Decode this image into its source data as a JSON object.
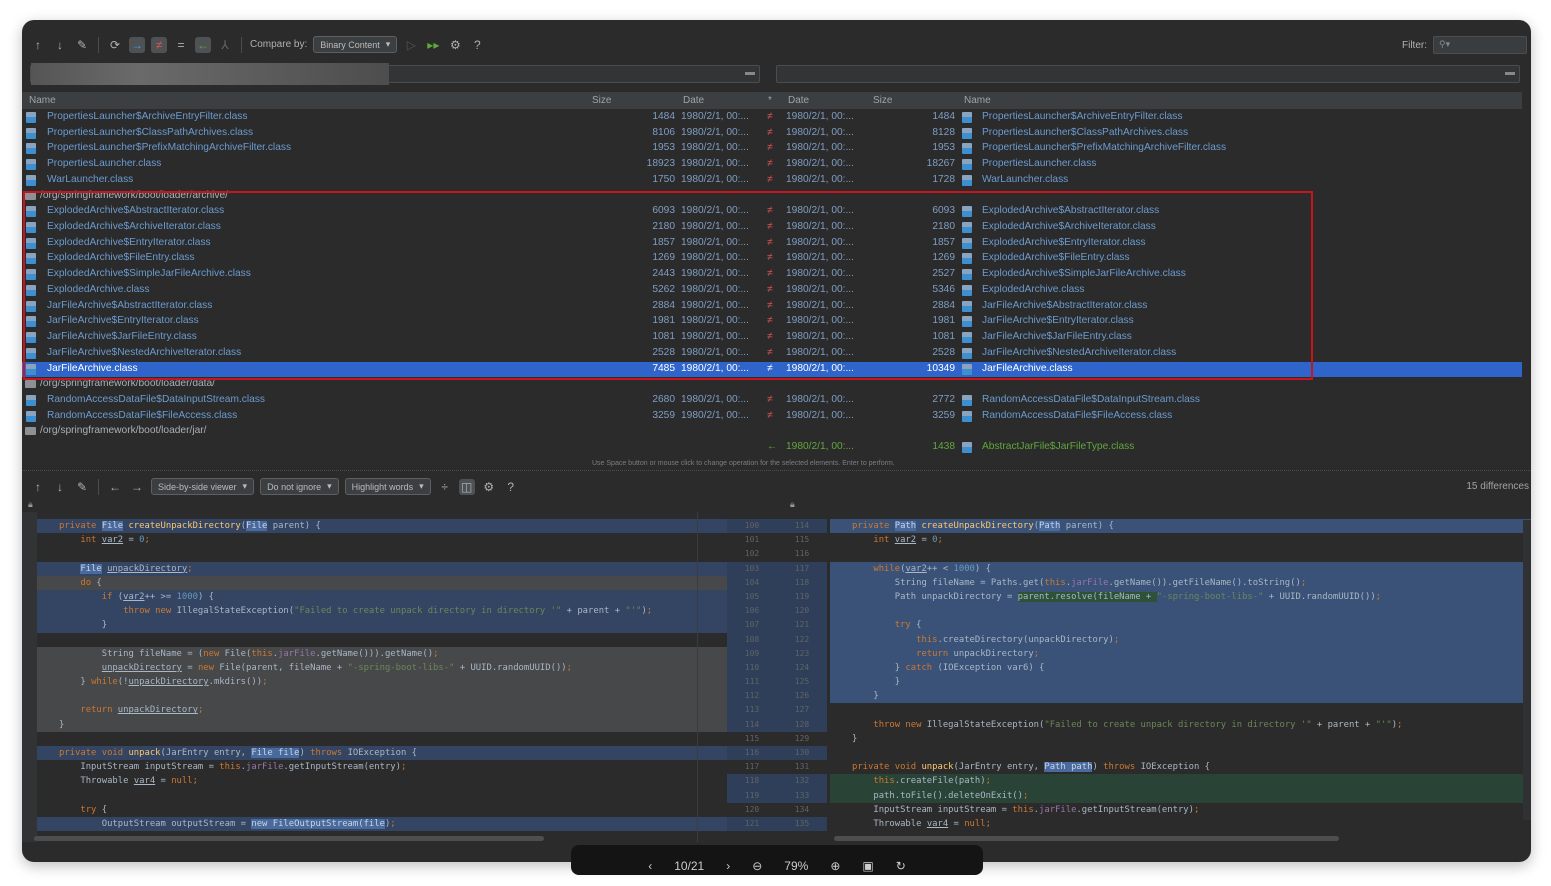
{
  "toolbar": {
    "compare_by_label": "Compare by:",
    "compare_by_value": "Binary Content",
    "filter_label": "Filter:",
    "filter_value": ""
  },
  "columns": {
    "name_left": "Name",
    "size_left": "Size",
    "date_left": "Date",
    "marker": "*",
    "date_right": "Date",
    "size_right": "Size",
    "name_right": "Name"
  },
  "rows": [
    {
      "type": "file",
      "left": "PropertiesLauncher$ArchiveEntryFilter.class",
      "lsize": "1484",
      "ldate": "1980/2/1, 00:...",
      "op": "≠",
      "rdate": "1980/2/1, 00:...",
      "rsize": "1484",
      "right": "PropertiesLauncher$ArchiveEntryFilter.class"
    },
    {
      "type": "file",
      "left": "PropertiesLauncher$ClassPathArchives.class",
      "lsize": "8106",
      "ldate": "1980/2/1, 00:...",
      "op": "≠",
      "rdate": "1980/2/1, 00:...",
      "rsize": "8128",
      "right": "PropertiesLauncher$ClassPathArchives.class"
    },
    {
      "type": "file",
      "left": "PropertiesLauncher$PrefixMatchingArchiveFilter.class",
      "lsize": "1953",
      "ldate": "1980/2/1, 00:...",
      "op": "≠",
      "rdate": "1980/2/1, 00:...",
      "rsize": "1953",
      "right": "PropertiesLauncher$PrefixMatchingArchiveFilter.class"
    },
    {
      "type": "file",
      "left": "PropertiesLauncher.class",
      "lsize": "18923",
      "ldate": "1980/2/1, 00:...",
      "op": "≠",
      "rdate": "1980/2/1, 00:...",
      "rsize": "18267",
      "right": "PropertiesLauncher.class"
    },
    {
      "type": "file",
      "left": "WarLauncher.class",
      "lsize": "1750",
      "ldate": "1980/2/1, 00:...",
      "op": "≠",
      "rdate": "1980/2/1, 00:...",
      "rsize": "1728",
      "right": "WarLauncher.class"
    },
    {
      "type": "folder",
      "left": "/org/springframework/boot/loader/archive/"
    },
    {
      "type": "file",
      "left": "ExplodedArchive$AbstractIterator.class",
      "lsize": "6093",
      "ldate": "1980/2/1, 00:...",
      "op": "≠",
      "rdate": "1980/2/1, 00:...",
      "rsize": "6093",
      "right": "ExplodedArchive$AbstractIterator.class"
    },
    {
      "type": "file",
      "left": "ExplodedArchive$ArchiveIterator.class",
      "lsize": "2180",
      "ldate": "1980/2/1, 00:...",
      "op": "≠",
      "rdate": "1980/2/1, 00:...",
      "rsize": "2180",
      "right": "ExplodedArchive$ArchiveIterator.class"
    },
    {
      "type": "file",
      "left": "ExplodedArchive$EntryIterator.class",
      "lsize": "1857",
      "ldate": "1980/2/1, 00:...",
      "op": "≠",
      "rdate": "1980/2/1, 00:...",
      "rsize": "1857",
      "right": "ExplodedArchive$EntryIterator.class"
    },
    {
      "type": "file",
      "left": "ExplodedArchive$FileEntry.class",
      "lsize": "1269",
      "ldate": "1980/2/1, 00:...",
      "op": "≠",
      "rdate": "1980/2/1, 00:...",
      "rsize": "1269",
      "right": "ExplodedArchive$FileEntry.class"
    },
    {
      "type": "file",
      "left": "ExplodedArchive$SimpleJarFileArchive.class",
      "lsize": "2443",
      "ldate": "1980/2/1, 00:...",
      "op": "≠",
      "rdate": "1980/2/1, 00:...",
      "rsize": "2527",
      "right": "ExplodedArchive$SimpleJarFileArchive.class"
    },
    {
      "type": "file",
      "left": "ExplodedArchive.class",
      "lsize": "5262",
      "ldate": "1980/2/1, 00:...",
      "op": "≠",
      "rdate": "1980/2/1, 00:...",
      "rsize": "5346",
      "right": "ExplodedArchive.class"
    },
    {
      "type": "file",
      "left": "JarFileArchive$AbstractIterator.class",
      "lsize": "2884",
      "ldate": "1980/2/1, 00:...",
      "op": "≠",
      "rdate": "1980/2/1, 00:...",
      "rsize": "2884",
      "right": "JarFileArchive$AbstractIterator.class"
    },
    {
      "type": "file",
      "left": "JarFileArchive$EntryIterator.class",
      "lsize": "1981",
      "ldate": "1980/2/1, 00:...",
      "op": "≠",
      "rdate": "1980/2/1, 00:...",
      "rsize": "1981",
      "right": "JarFileArchive$EntryIterator.class"
    },
    {
      "type": "file",
      "left": "JarFileArchive$JarFileEntry.class",
      "lsize": "1081",
      "ldate": "1980/2/1, 00:...",
      "op": "≠",
      "rdate": "1980/2/1, 00:...",
      "rsize": "1081",
      "right": "JarFileArchive$JarFileEntry.class"
    },
    {
      "type": "file",
      "left": "JarFileArchive$NestedArchiveIterator.class",
      "lsize": "2528",
      "ldate": "1980/2/1, 00:...",
      "op": "≠",
      "rdate": "1980/2/1, 00:...",
      "rsize": "2528",
      "right": "JarFileArchive$NestedArchiveIterator.class"
    },
    {
      "type": "file",
      "selected": true,
      "left": "JarFileArchive.class",
      "lsize": "7485",
      "ldate": "1980/2/1, 00:...",
      "op": "≠",
      "rdate": "1980/2/1, 00:...",
      "rsize": "10349",
      "right": "JarFileArchive.class"
    },
    {
      "type": "folder",
      "left": "/org/springframework/boot/loader/data/"
    },
    {
      "type": "file",
      "left": "RandomAccessDataFile$DataInputStream.class",
      "lsize": "2680",
      "ldate": "1980/2/1, 00:...",
      "op": "≠",
      "rdate": "1980/2/1, 00:...",
      "rsize": "2772",
      "right": "RandomAccessDataFile$DataInputStream.class"
    },
    {
      "type": "file",
      "left": "RandomAccessDataFile$FileAccess.class",
      "lsize": "3259",
      "ldate": "1980/2/1, 00:...",
      "op": "≠",
      "rdate": "1980/2/1, 00:...",
      "rsize": "3259",
      "right": "RandomAccessDataFile$FileAccess.class"
    },
    {
      "type": "folder",
      "left": "/org/springframework/boot/loader/jar/"
    },
    {
      "type": "rightonly",
      "left": "",
      "lsize": "",
      "ldate": "",
      "op": "←",
      "rdate": "1980/2/1, 00:...",
      "rsize": "1438",
      "right": "AbstractJarFile$JarFileType.class"
    }
  ],
  "status_hint": "Use Space button or mouse click to change operation for the selected elements. Enter to perform.",
  "diff_toolbar": {
    "viewer": "Side-by-side viewer",
    "ignore": "Do not ignore",
    "highlight": "Highlight words",
    "differences": "15 differences"
  },
  "left_code": [
    {
      "bg": "chg",
      "t": [
        [
          "k",
          "private "
        ],
        [
          "h",
          "File"
        ],
        [
          "p",
          " "
        ],
        [
          "m",
          "createUnpackDirectory"
        ],
        [
          "p",
          "("
        ],
        [
          "h",
          "File"
        ],
        [
          "p",
          " parent) {"
        ]
      ]
    },
    {
      "bg": "",
      "t": [
        [
          "p",
          "    "
        ],
        [
          "k",
          "int "
        ],
        [
          "u",
          "var2"
        ],
        [
          "p",
          " = "
        ],
        [
          "n",
          "0"
        ],
        [
          "k",
          ";"
        ]
      ]
    },
    {
      "bg": "",
      "t": []
    },
    {
      "bg": "chg",
      "t": [
        [
          "p",
          "    "
        ],
        [
          "h",
          "File"
        ],
        [
          "p",
          " "
        ],
        [
          "u",
          "unpackDirectory"
        ],
        [
          "k",
          ";"
        ]
      ]
    },
    {
      "bg": "mod",
      "t": [
        [
          "p",
          "    "
        ],
        [
          "k",
          "do"
        ],
        [
          "p",
          " {"
        ]
      ]
    },
    {
      "bg": "chg",
      "t": [
        [
          "p",
          "        "
        ],
        [
          "k",
          "if"
        ],
        [
          "p",
          " ("
        ],
        [
          "u",
          "var2"
        ],
        [
          "p",
          "++ >= "
        ],
        [
          "n",
          "1000"
        ],
        [
          "p",
          ") {"
        ]
      ]
    },
    {
      "bg": "chg",
      "t": [
        [
          "p",
          "            "
        ],
        [
          "k",
          "throw new "
        ],
        [
          "p",
          "IllegalStateException("
        ],
        [
          "s",
          "\"Failed to create unpack directory in directory '\""
        ],
        [
          "p",
          " + parent + "
        ],
        [
          "s",
          "\"'\""
        ],
        [
          "p",
          ")"
        ],
        [
          "k",
          ";"
        ]
      ]
    },
    {
      "bg": "chg",
      "t": [
        [
          "p",
          "        }"
        ]
      ]
    },
    {
      "bg": "",
      "t": []
    },
    {
      "bg": "mod",
      "t": [
        [
          "p",
          "        String fileName = ("
        ],
        [
          "k",
          "new "
        ],
        [
          "p",
          "File("
        ],
        [
          "k",
          "this"
        ],
        [
          "p",
          "."
        ],
        [
          "f",
          "jarFile"
        ],
        [
          "p",
          ".getName())).getName()"
        ],
        [
          "k",
          ";"
        ]
      ]
    },
    {
      "bg": "mod",
      "t": [
        [
          "p",
          "        "
        ],
        [
          "u",
          "unpackDirectory"
        ],
        [
          "p",
          " = "
        ],
        [
          "k",
          "new "
        ],
        [
          "p",
          "File(parent, fileName + "
        ],
        [
          "s",
          "\"-spring-boot-libs-\""
        ],
        [
          "p",
          " + UUID.randomUUID())"
        ],
        [
          "k",
          ";"
        ]
      ]
    },
    {
      "bg": "mod",
      "t": [
        [
          "p",
          "    } "
        ],
        [
          "k",
          "while"
        ],
        [
          "p",
          "(!"
        ],
        [
          "u",
          "unpackDirectory"
        ],
        [
          "p",
          ".mkdirs())"
        ],
        [
          "k",
          ";"
        ]
      ]
    },
    {
      "bg": "mod",
      "t": []
    },
    {
      "bg": "mod",
      "t": [
        [
          "p",
          "    "
        ],
        [
          "k",
          "return "
        ],
        [
          "u",
          "unpackDirectory"
        ],
        [
          "k",
          ";"
        ]
      ]
    },
    {
      "bg": "mod",
      "t": [
        [
          "p",
          "}"
        ]
      ]
    },
    {
      "bg": "",
      "t": []
    },
    {
      "bg": "chg",
      "t": [
        [
          "k",
          "private void "
        ],
        [
          "m",
          "unpack"
        ],
        [
          "p",
          "(JarEntry entry, "
        ],
        [
          "h",
          "File file"
        ],
        [
          "p",
          ") "
        ],
        [
          "k",
          "throws "
        ],
        [
          "p",
          "IOException {"
        ]
      ]
    },
    {
      "bg": "",
      "t": [
        [
          "p",
          "    InputStream inputStream = "
        ],
        [
          "k",
          "this"
        ],
        [
          "p",
          "."
        ],
        [
          "f",
          "jarFile"
        ],
        [
          "p",
          ".getInputStream(entry)"
        ],
        [
          "k",
          ";"
        ]
      ]
    },
    {
      "bg": "",
      "t": [
        [
          "p",
          "    Throwable "
        ],
        [
          "u",
          "var4"
        ],
        [
          "p",
          " = "
        ],
        [
          "k",
          "null;"
        ]
      ]
    },
    {
      "bg": "",
      "t": []
    },
    {
      "bg": "",
      "t": [
        [
          "p",
          "    "
        ],
        [
          "k",
          "try"
        ],
        [
          "p",
          " {"
        ]
      ]
    },
    {
      "bg": "chg",
      "t": [
        [
          "p",
          "        OutputStream outputStream = "
        ],
        [
          "h",
          "new FileOutputStream(file"
        ],
        [
          "p",
          ")"
        ],
        [
          "k",
          ";"
        ]
      ]
    }
  ],
  "right_code": [
    {
      "bg": "chg",
      "t": [
        [
          "k",
          "private "
        ],
        [
          "h",
          "Path"
        ],
        [
          "p",
          " "
        ],
        [
          "m",
          "createUnpackDirectory"
        ],
        [
          "p",
          "("
        ],
        [
          "h",
          "Path"
        ],
        [
          "p",
          " parent) {"
        ]
      ]
    },
    {
      "bg": "",
      "t": [
        [
          "p",
          "    "
        ],
        [
          "k",
          "int "
        ],
        [
          "u",
          "var2"
        ],
        [
          "p",
          " = "
        ],
        [
          "n",
          "0"
        ],
        [
          "k",
          ";"
        ]
      ]
    },
    {
      "bg": "",
      "t": []
    },
    {
      "bg": "chg",
      "t": [
        [
          "p",
          "    "
        ],
        [
          "k",
          "while"
        ],
        [
          "p",
          "("
        ],
        [
          "u",
          "var2"
        ],
        [
          "p",
          "++ < "
        ],
        [
          "n",
          "1000"
        ],
        [
          "p",
          ") {"
        ]
      ]
    },
    {
      "bg": "chg",
      "t": [
        [
          "p",
          "        String fileName = Paths.get("
        ],
        [
          "k",
          "this"
        ],
        [
          "p",
          "."
        ],
        [
          "f",
          "jarFile"
        ],
        [
          "p",
          ".getName()).getFileName().toString()"
        ],
        [
          "k",
          ";"
        ]
      ]
    },
    {
      "bg": "chg",
      "t": [
        [
          "p",
          "        Path unpackDirectory = "
        ],
        [
          "g",
          "parent.resolve(fileName + "
        ],
        [
          "s",
          "\"-spring-boot-libs-\""
        ],
        [
          "p",
          " + UUID.randomUUID())"
        ],
        [
          "k",
          ";"
        ]
      ]
    },
    {
      "bg": "chg",
      "t": []
    },
    {
      "bg": "chg",
      "t": [
        [
          "p",
          "        "
        ],
        [
          "k",
          "try"
        ],
        [
          "p",
          " {"
        ]
      ]
    },
    {
      "bg": "chg",
      "t": [
        [
          "p",
          "            "
        ],
        [
          "k",
          "this"
        ],
        [
          "p",
          ".createDirectory(unpackDirectory)"
        ],
        [
          "k",
          ";"
        ]
      ]
    },
    {
      "bg": "chg",
      "t": [
        [
          "p",
          "            "
        ],
        [
          "k",
          "return "
        ],
        [
          "p",
          "unpackDirectory"
        ],
        [
          "k",
          ";"
        ]
      ]
    },
    {
      "bg": "chg",
      "t": [
        [
          "p",
          "        } "
        ],
        [
          "k",
          "catch "
        ],
        [
          "p",
          "(IOException var6) {"
        ]
      ]
    },
    {
      "bg": "chg",
      "t": [
        [
          "p",
          "        }"
        ]
      ]
    },
    {
      "bg": "chg",
      "t": [
        [
          "p",
          "    }"
        ]
      ]
    },
    {
      "bg": "",
      "t": []
    },
    {
      "bg": "",
      "t": [
        [
          "p",
          "    "
        ],
        [
          "k",
          "throw new "
        ],
        [
          "p",
          "IllegalStateException("
        ],
        [
          "s",
          "\"Failed to create unpack directory in directory '\""
        ],
        [
          "p",
          " + parent + "
        ],
        [
          "s",
          "\"'\""
        ],
        [
          "p",
          ")"
        ],
        [
          "k",
          ";"
        ]
      ]
    },
    {
      "bg": "",
      "t": [
        [
          "p",
          "}"
        ]
      ]
    },
    {
      "bg": "",
      "t": []
    },
    {
      "bg": "",
      "t": [
        [
          "k",
          "private void "
        ],
        [
          "m",
          "unpack"
        ],
        [
          "p",
          "(JarEntry entry, "
        ],
        [
          "h",
          "Path path"
        ],
        [
          "p",
          ") "
        ],
        [
          "k",
          "throws "
        ],
        [
          "p",
          "IOException {"
        ]
      ]
    },
    {
      "bg": "ins",
      "t": [
        [
          "p",
          "    "
        ],
        [
          "k",
          "this"
        ],
        [
          "p",
          ".createFile(path)"
        ],
        [
          "k",
          ";"
        ]
      ]
    },
    {
      "bg": "ins",
      "t": [
        [
          "p",
          "    path.toFile().deleteOnExit()"
        ],
        [
          "k",
          ";"
        ]
      ]
    },
    {
      "bg": "",
      "t": [
        [
          "p",
          "    InputStream inputStream = "
        ],
        [
          "k",
          "this"
        ],
        [
          "p",
          "."
        ],
        [
          "f",
          "jarFile"
        ],
        [
          "p",
          ".getInputStream(entry)"
        ],
        [
          "k",
          ";"
        ]
      ]
    },
    {
      "bg": "",
      "t": [
        [
          "p",
          "    Throwable "
        ],
        [
          "u",
          "var4"
        ],
        [
          "p",
          " = "
        ],
        [
          "k",
          "null;"
        ]
      ]
    }
  ],
  "gutter": {
    "left_start": 100,
    "right_start": 114
  },
  "viewer_overlay": {
    "page": "10/21",
    "zoom": "79%"
  }
}
